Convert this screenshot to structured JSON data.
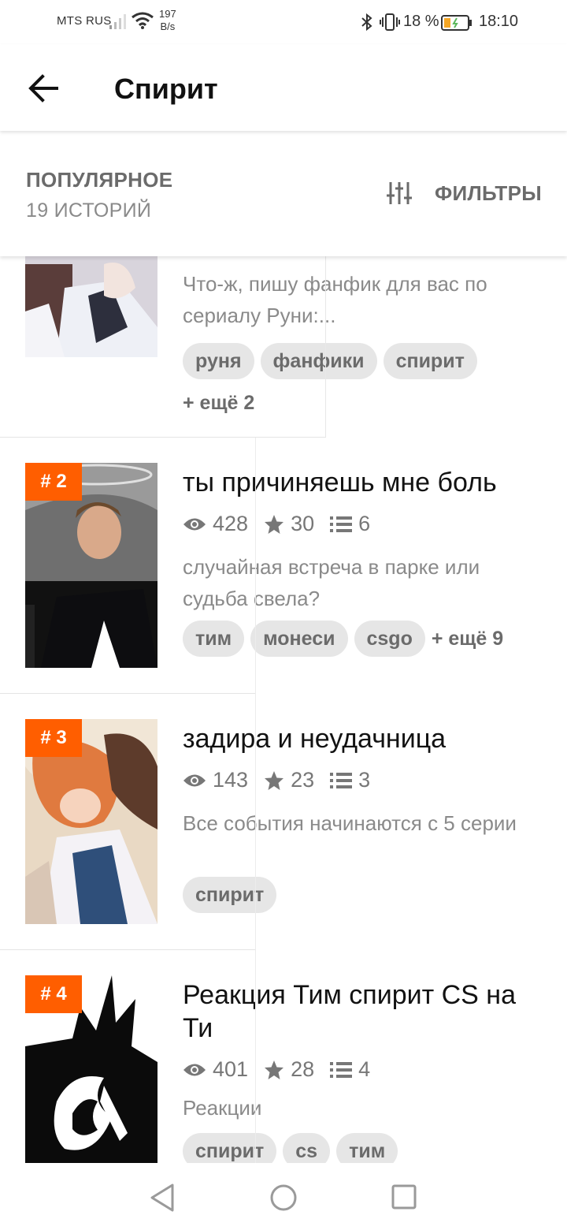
{
  "status_bar": {
    "carrier": "MTS RUS",
    "speed_value": "197",
    "speed_unit": "B/s",
    "battery_percent": "18 %",
    "time": "18:10"
  },
  "app_bar": {
    "title": "Спирит",
    "back_icon": "arrow-left-icon"
  },
  "list_header": {
    "sort_label": "ПОПУЛЯРНОЕ",
    "count_label": "19 ИСТОРИЙ",
    "filter_label": "ФИЛЬТРЫ",
    "filter_icon": "sliders-icon"
  },
  "stories": [
    {
      "description": "Что-ж, пишу фанфик для вас по сериалу Руни:...",
      "tags": [
        "руня",
        "фанфики",
        "спирит"
      ],
      "more_tags": "+ ещё 2"
    },
    {
      "rank": "# 2",
      "title": "ты причиняешь мне боль",
      "views": "428",
      "stars": "30",
      "parts": "6",
      "description": "случайная встреча в парке или судьба свела?",
      "tags": [
        "тим",
        "монеси",
        "csgo"
      ],
      "more_tags": "+ ещё 9"
    },
    {
      "rank": "# 3",
      "title": "задира и неудачница",
      "views": "143",
      "stars": "23",
      "parts": "3",
      "description": "Все события начинаются с 5 серии",
      "tags": [
        "спирит"
      ]
    },
    {
      "rank": "# 4",
      "title": "Реакция Тим спирит CS на Ти",
      "views": "401",
      "stars": "28",
      "parts": "4",
      "description": "Реакции",
      "tags": [
        "спирит",
        "cs",
        "тим"
      ]
    }
  ],
  "colors": {
    "accent": "#ff5e00",
    "tag_bg": "#e6e6e6",
    "muted_text": "#8a8a8a"
  }
}
